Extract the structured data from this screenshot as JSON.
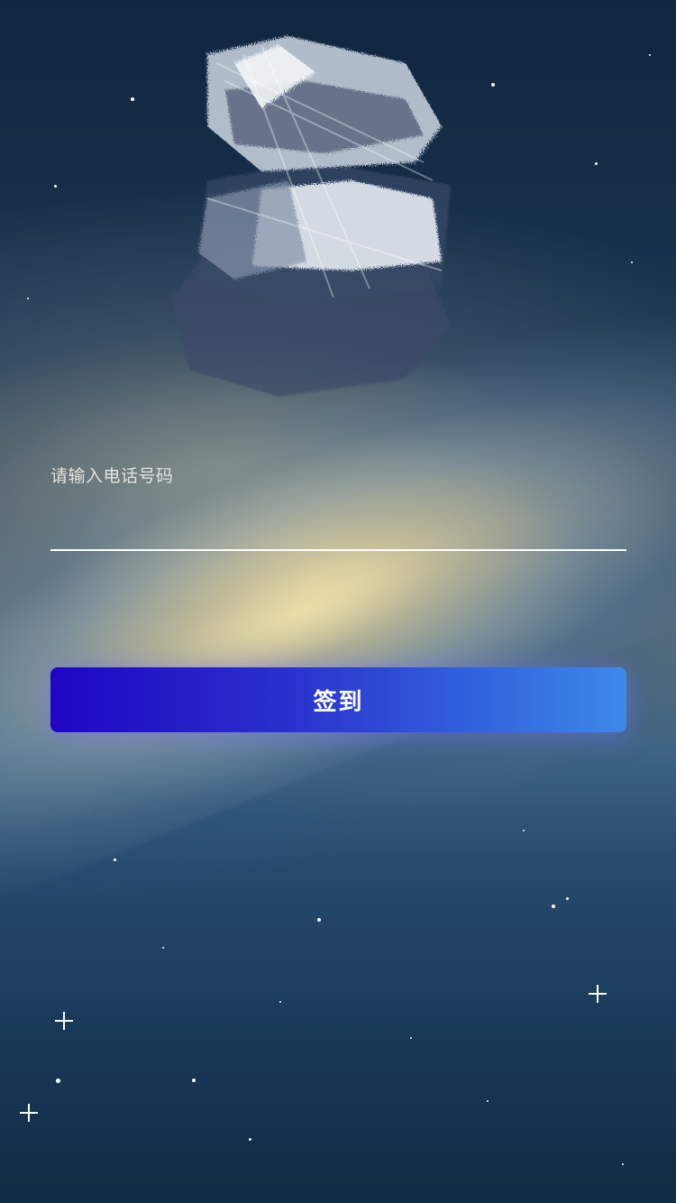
{
  "form": {
    "phone_label": "请输入电话号码",
    "phone_value": "",
    "submit_label": "签到"
  },
  "colors": {
    "button_start": "#1f06c4",
    "button_end": "#3d8ae8",
    "underline": "#ffffff",
    "label": "#e3e3de"
  },
  "icons": {
    "logo": "brush-painted-logo"
  }
}
